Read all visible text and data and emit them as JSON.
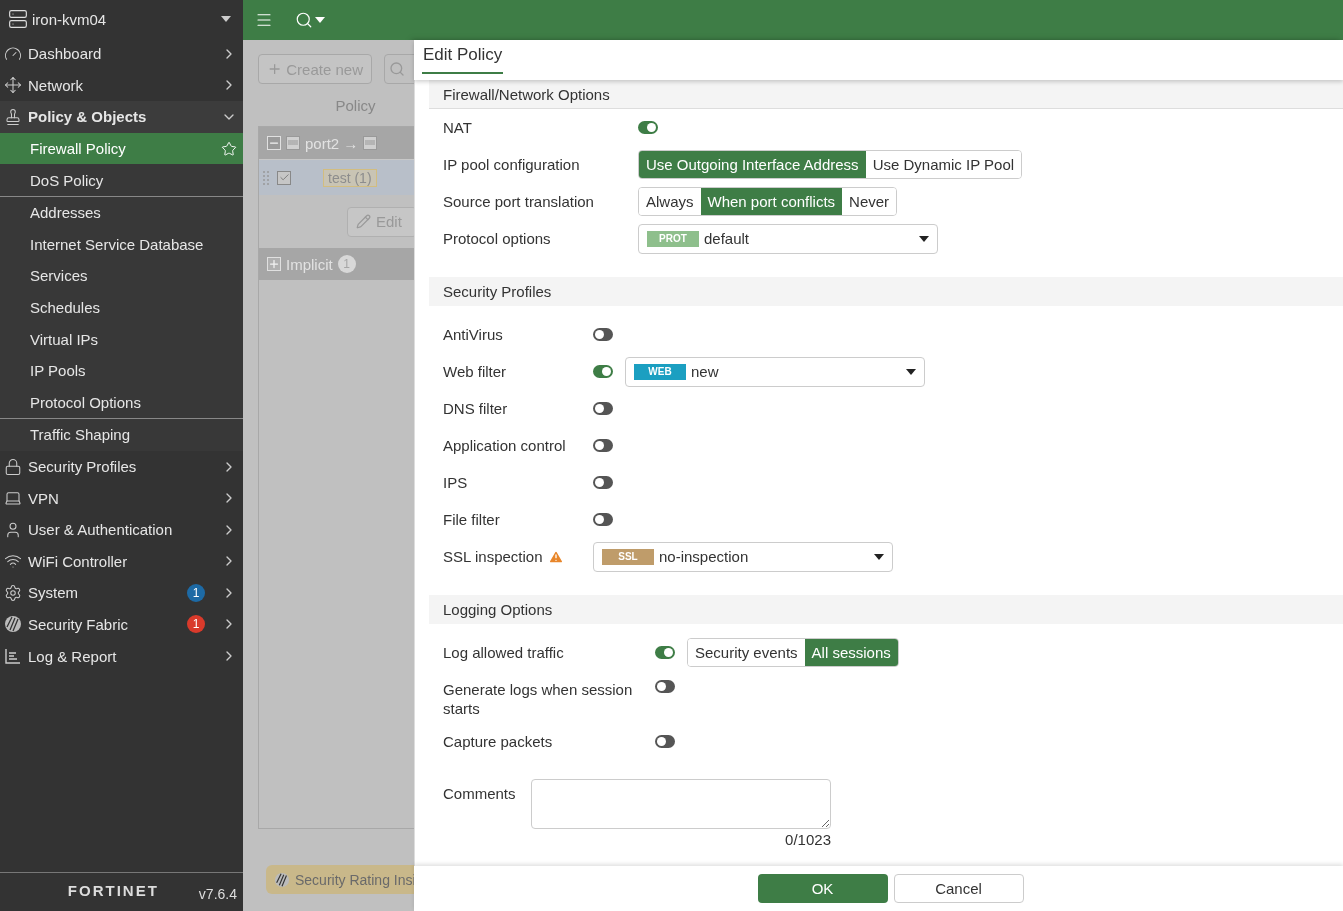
{
  "sidebar": {
    "device": "iron-kvm04",
    "items": [
      {
        "label": "Dashboard",
        "expanded": false
      },
      {
        "label": "Network",
        "expanded": false
      },
      {
        "label": "Policy & Objects",
        "expanded": true,
        "child_groups": [
          {
            "items": [
              {
                "label": "Firewall Policy",
                "selected": true,
                "favorite": true
              },
              {
                "label": "DoS Policy",
                "selected": false,
                "favorite": false
              }
            ]
          },
          {
            "items": [
              {
                "label": "Addresses",
                "selected": false,
                "favorite": false
              },
              {
                "label": "Internet Service Database",
                "selected": false,
                "favorite": false
              },
              {
                "label": "Services",
                "selected": false,
                "favorite": false
              },
              {
                "label": "Schedules",
                "selected": false,
                "favorite": false
              },
              {
                "label": "Virtual IPs",
                "selected": false,
                "favorite": false
              },
              {
                "label": "IP Pools",
                "selected": false,
                "favorite": false
              },
              {
                "label": "Protocol Options",
                "selected": false,
                "favorite": false
              }
            ]
          },
          {
            "items": [
              {
                "label": "Traffic Shaping",
                "selected": false,
                "favorite": false
              }
            ]
          }
        ]
      },
      {
        "label": "Security Profiles",
        "expanded": false
      },
      {
        "label": "VPN",
        "expanded": false
      },
      {
        "label": "User & Authentication",
        "expanded": false
      },
      {
        "label": "WiFi Controller",
        "expanded": false
      },
      {
        "label": "System",
        "expanded": false,
        "badge": "1",
        "color": "#1d6aa5"
      },
      {
        "label": "Security Fabric",
        "expanded": false,
        "badge": "1",
        "color": "#d93a2b"
      },
      {
        "label": "Log & Report",
        "expanded": false
      }
    ],
    "logo": "FORTINET",
    "version": "v7.6.4"
  },
  "policy_list": {
    "create_button": "Create new",
    "column": "Policy",
    "groups": [
      {
        "label": "port2 →",
        "expanded": true
      },
      {
        "label": "Implicit",
        "count": "1",
        "expanded": false
      }
    ],
    "rows": [
      {
        "name": "test (1)",
        "checked": true
      }
    ],
    "edit_button": "Edit",
    "rating_button": "Security Rating Insi"
  },
  "dialog": {
    "title": "Edit Policy",
    "sections": [
      {
        "title": "Firewall/Network Options",
        "rows": [
          {
            "kind": "toggle",
            "label": "NAT",
            "on": true
          },
          {
            "kind": "segmented",
            "label": "IP pool configuration",
            "options": [
              {
                "label": "Use Outgoing Interface Address",
                "selected": true
              },
              {
                "label": "Use Dynamic IP Pool",
                "selected": false
              }
            ]
          },
          {
            "kind": "segmented",
            "label": "Source port translation",
            "options": [
              {
                "label": "Always",
                "selected": false
              },
              {
                "label": "When port conflicts",
                "selected": true
              },
              {
                "label": "Never",
                "selected": false
              }
            ]
          },
          {
            "kind": "select",
            "label": "Protocol options",
            "tag": "PROT",
            "color": "#8ebf8c",
            "value": "default"
          }
        ]
      },
      {
        "title": "Security Profiles",
        "rows": [
          {
            "kind": "toggle",
            "label": "AntiVirus",
            "on": false
          },
          {
            "kind": "toggle_select",
            "label": "Web filter",
            "on": true,
            "tag": "WEB",
            "color": "#1b9fc1",
            "value": "new"
          },
          {
            "kind": "toggle",
            "label": "DNS filter",
            "on": false
          },
          {
            "kind": "toggle",
            "label": "Application control",
            "on": false
          },
          {
            "kind": "toggle",
            "label": "IPS",
            "on": false
          },
          {
            "kind": "toggle",
            "label": "File filter",
            "on": false
          },
          {
            "kind": "select",
            "label": "SSL inspection",
            "warning": true,
            "tag": "SSL",
            "color": "#bf9c6a",
            "value": "no-inspection"
          }
        ]
      },
      {
        "title": "Logging Options",
        "rows": [
          {
            "kind": "toggle_segmented",
            "label": "Log allowed traffic",
            "on": true,
            "options": [
              {
                "label": "Security events",
                "selected": false
              },
              {
                "label": "All sessions",
                "selected": true
              }
            ]
          },
          {
            "kind": "toggle",
            "label": "Generate logs when session starts",
            "on": false
          },
          {
            "kind": "toggle",
            "label": "Capture packets",
            "on": false
          },
          {
            "kind": "textarea",
            "label": "Comments",
            "counter": "0/1023"
          }
        ]
      }
    ],
    "buttons": [
      {
        "label": "OK",
        "primary": true
      },
      {
        "label": "Cancel",
        "primary": false
      }
    ]
  }
}
